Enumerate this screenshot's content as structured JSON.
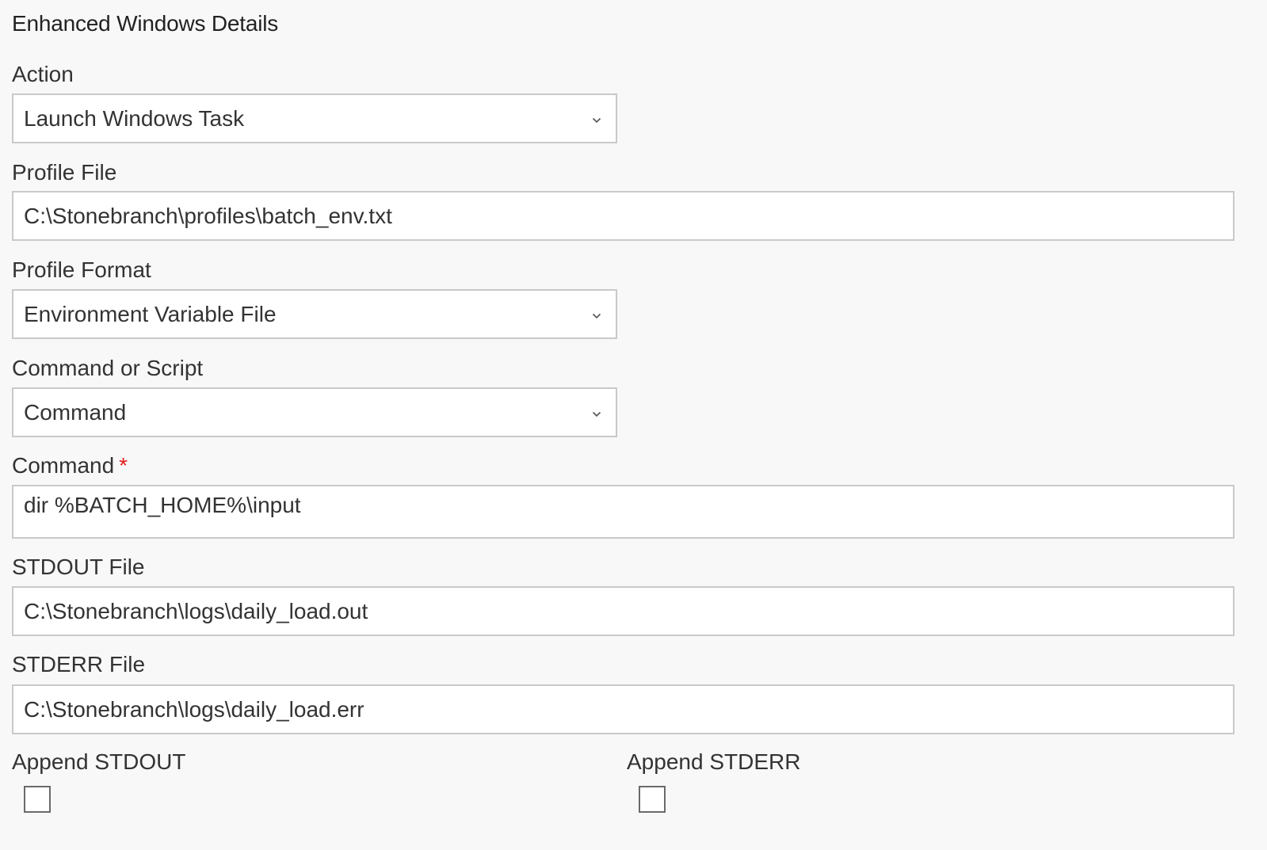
{
  "section_title": "Enhanced Windows Details",
  "fields": {
    "action": {
      "label": "Action",
      "value": "Launch Windows Task"
    },
    "profile_file": {
      "label": "Profile File",
      "value": "C:\\Stonebranch\\profiles\\batch_env.txt"
    },
    "profile_format": {
      "label": "Profile Format",
      "value": "Environment Variable File"
    },
    "command_or_script": {
      "label": "Command or Script",
      "value": "Command"
    },
    "command": {
      "label": "Command",
      "required_marker": "*",
      "value": "dir %BATCH_HOME%\\input"
    },
    "stdout_file": {
      "label": "STDOUT File",
      "value": "C:\\Stonebranch\\logs\\daily_load.out"
    },
    "stderr_file": {
      "label": "STDERR File",
      "value": "C:\\Stonebranch\\logs\\daily_load.err"
    }
  },
  "checkboxes": {
    "append_stdout": {
      "label": "Append STDOUT",
      "checked": false
    },
    "append_stderr": {
      "label": "Append STDERR",
      "checked": false
    }
  },
  "icons": {
    "dropdown": "chevron-down-icon"
  },
  "colors": {
    "background": "#f8f8f8",
    "field_background": "#ffffff",
    "border": "#c9c9c9",
    "required": "#e01b1b",
    "text": "#333333"
  }
}
